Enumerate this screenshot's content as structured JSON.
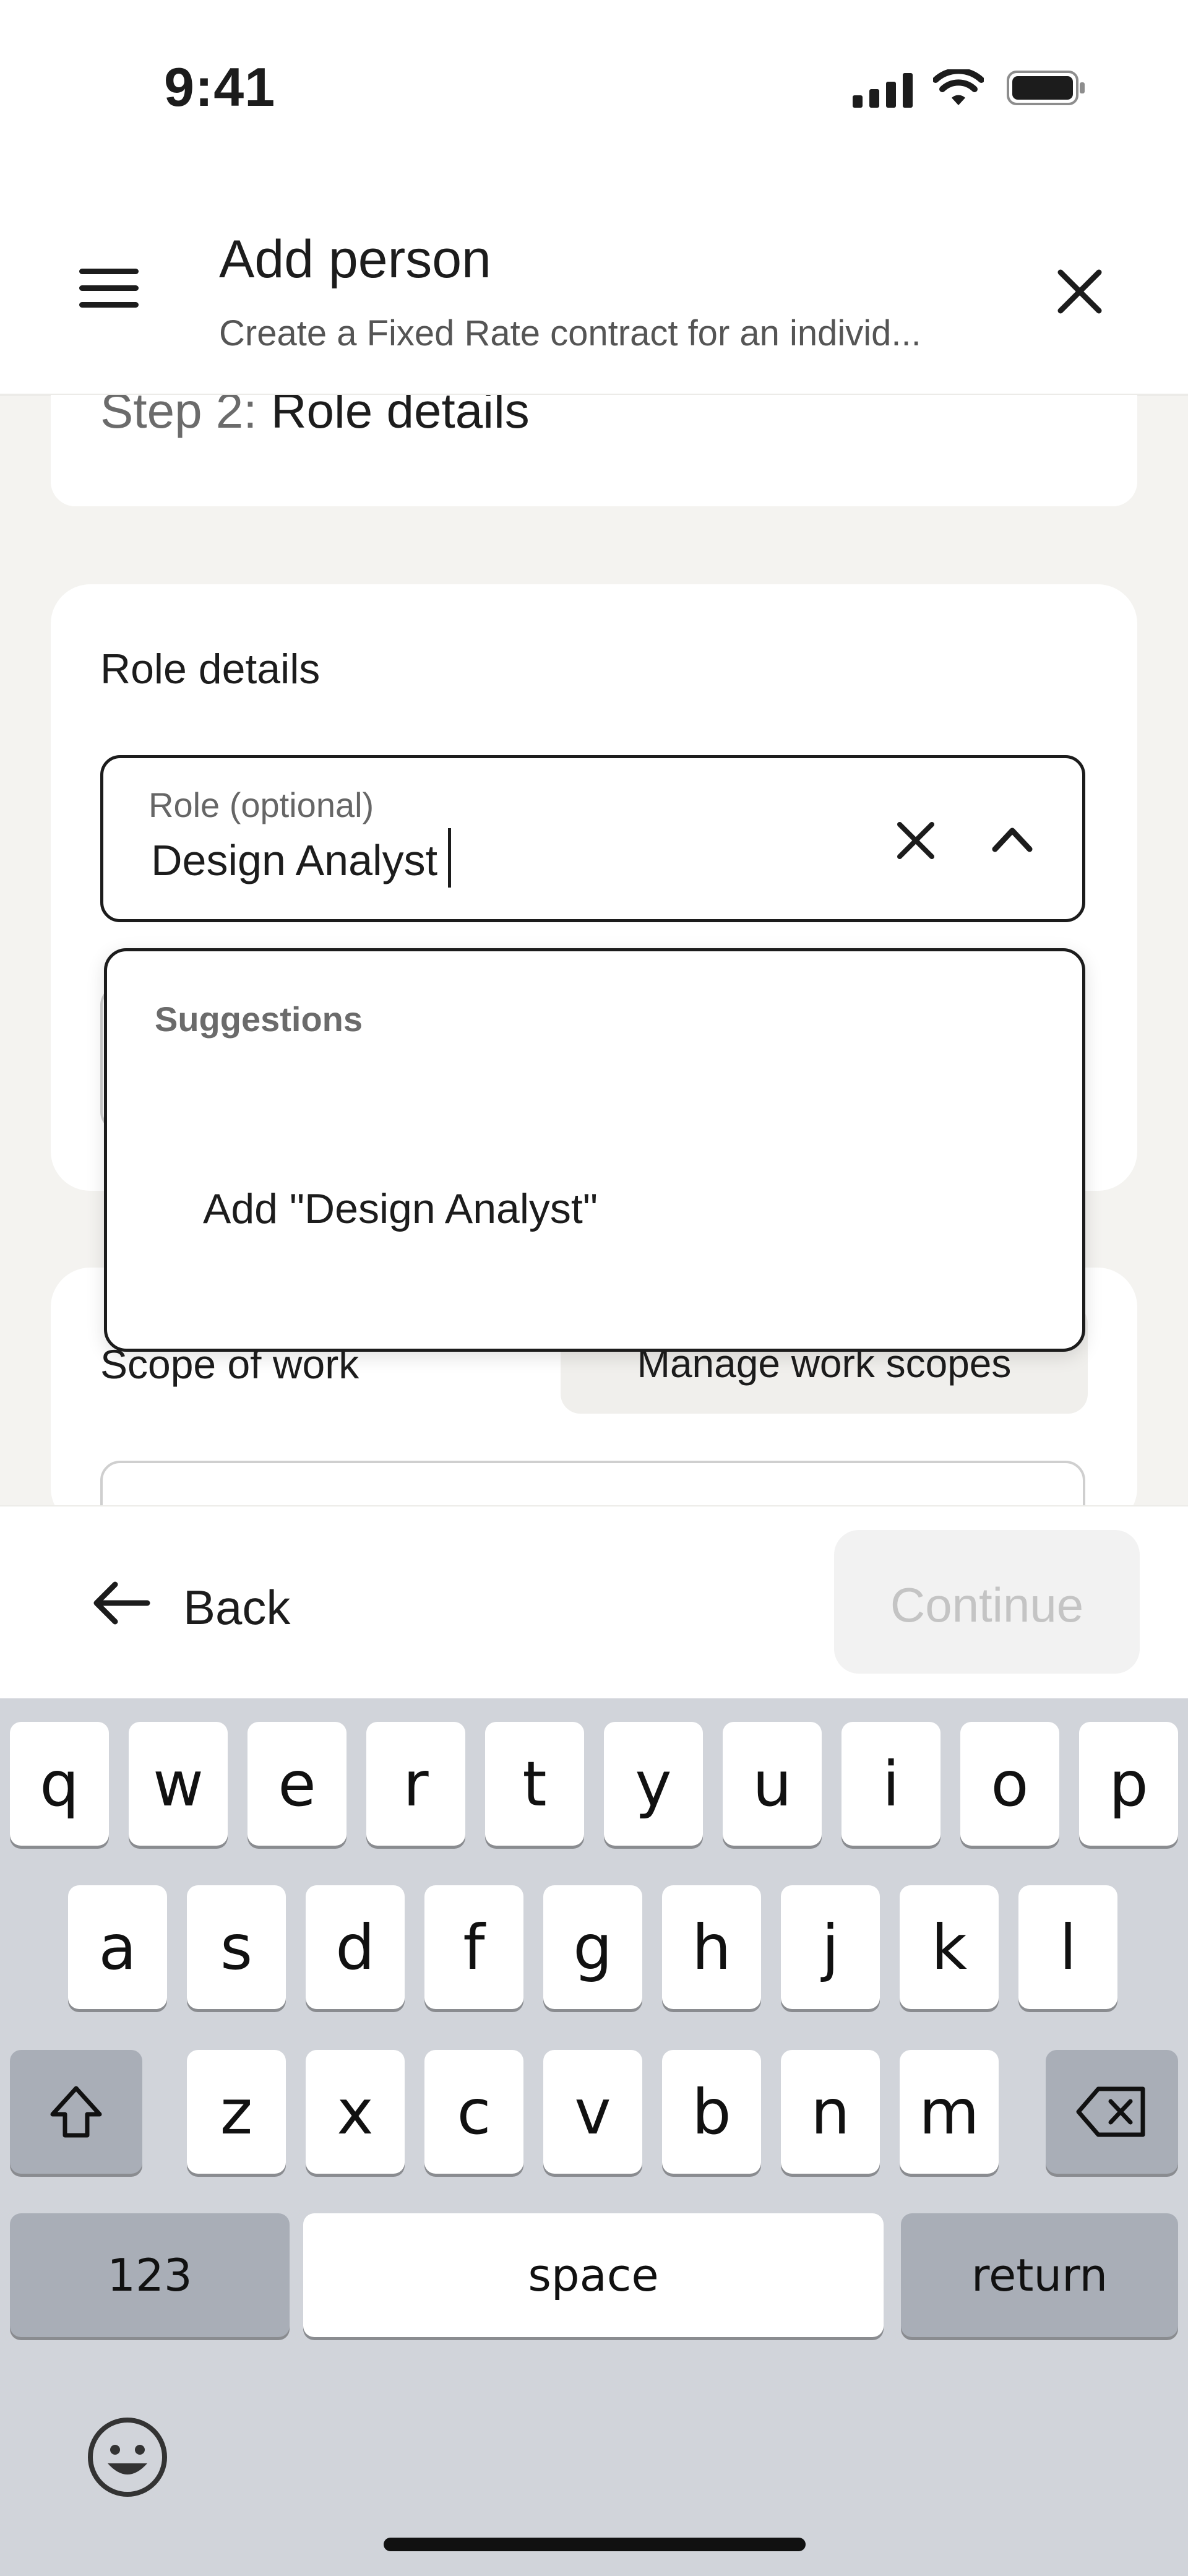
{
  "status_bar": {
    "time": "9:41",
    "icons": [
      "cellular-signal-icon",
      "wifi-icon",
      "battery-icon"
    ]
  },
  "header": {
    "menu_icon": "hamburger-menu-icon",
    "title": "Add person",
    "subtitle": "Create a Fixed Rate contract for an individ...",
    "close_icon": "close-icon"
  },
  "step": {
    "prefix": "Step 2:",
    "name": "Role details"
  },
  "role_card": {
    "heading": "Role details",
    "role_field": {
      "label": "Role (optional)",
      "value": "Design Analyst",
      "clear_icon": "clear-icon",
      "toggle_icon": "chevron-up-icon"
    }
  },
  "suggestions": {
    "heading": "Suggestions",
    "add_item": "Add \"Design Analyst\""
  },
  "scope_card": {
    "label": "Scope of work",
    "manage_button": "Manage work scopes"
  },
  "actions": {
    "back_label": "Back",
    "continue_label": "Continue"
  },
  "keyboard": {
    "row1": [
      "q",
      "w",
      "e",
      "r",
      "t",
      "y",
      "u",
      "i",
      "o",
      "p"
    ],
    "row2": [
      "a",
      "s",
      "d",
      "f",
      "g",
      "h",
      "j",
      "k",
      "l"
    ],
    "row3": [
      "z",
      "x",
      "c",
      "v",
      "b",
      "n",
      "m"
    ],
    "numbers_key": "123",
    "space_key": "space",
    "return_key": "return",
    "shift_icon": "shift-icon",
    "delete_icon": "delete-icon",
    "emoji_icon": "emoji-icon"
  },
  "colors": {
    "background": "#f4f3f0",
    "surface": "#ffffff",
    "text": "#1c1c1c",
    "muted": "#6b6b6b",
    "disabled_button": "#f2f2f2",
    "keyboard": "#d1d4da",
    "keyboard_dark_key": "#a9aeb7"
  }
}
